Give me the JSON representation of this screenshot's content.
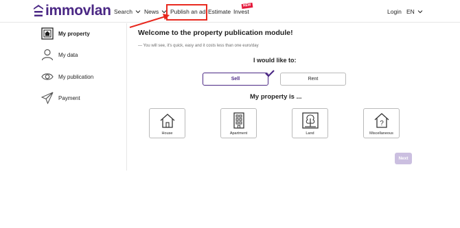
{
  "header": {
    "logo_text": "immovlan",
    "nav": {
      "search": "Search",
      "news": "News",
      "publish": "Publish an ad",
      "estimate": "Estimate",
      "invest": "Invest",
      "new_badge": "NEW",
      "login": "Login",
      "lang": "EN"
    }
  },
  "sidebar": {
    "items": [
      {
        "label": "My property",
        "icon": "property-icon",
        "active": true
      },
      {
        "label": "My data",
        "icon": "user-icon",
        "active": false
      },
      {
        "label": "My publication",
        "icon": "eye-icon",
        "active": false
      },
      {
        "label": "Payment",
        "icon": "paper-plane-icon",
        "active": false
      }
    ]
  },
  "main": {
    "welcome": "Welcome to the property publication module!",
    "subtitle": "— You will see, it's quick, easy and it costs less than one euro/day",
    "like_title": "I would like to:",
    "choices": {
      "sell": "Sell",
      "rent": "Rent",
      "selected": "sell"
    },
    "property_title": "My property is ...",
    "property_types": [
      {
        "label": "House",
        "icon": "house-icon"
      },
      {
        "label": "Apartment",
        "icon": "apartment-icon"
      },
      {
        "label": "Land",
        "icon": "land-icon"
      },
      {
        "label": "Miscellaneous",
        "icon": "question-house-icon"
      }
    ],
    "next": "Next"
  },
  "colors": {
    "brand": "#4a2784",
    "highlight": "#e8281e",
    "badge": "#e4183a",
    "next_disabled": "#cbbfe0"
  }
}
